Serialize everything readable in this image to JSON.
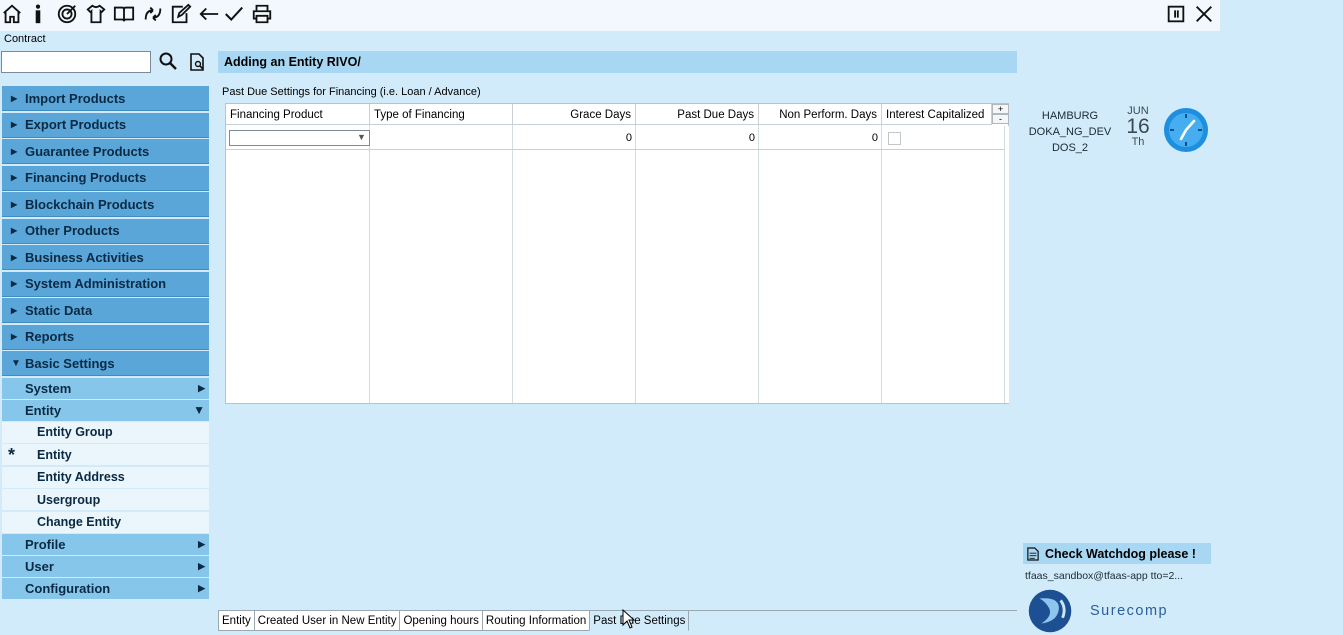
{
  "toolbar": {
    "icons": [
      "home-icon",
      "info-icon",
      "target-icon",
      "shirt-icon",
      "book-icon",
      "flow-icon",
      "edit-icon",
      "back-arrow-icon",
      "check-icon",
      "print-icon"
    ],
    "right_icons": [
      "window-toggle-icon",
      "close-icon"
    ]
  },
  "contract": {
    "label": "Contract",
    "value": ""
  },
  "sidebar": {
    "main_items": [
      {
        "label": "Import Products"
      },
      {
        "label": "Export Products"
      },
      {
        "label": "Guarantee Products"
      },
      {
        "label": "Financing Products"
      },
      {
        "label": "Blockchain Products"
      },
      {
        "label": "Other Products"
      },
      {
        "label": "Business Activities"
      },
      {
        "label": "System Administration"
      },
      {
        "label": "Static Data"
      },
      {
        "label": "Reports"
      },
      {
        "label": "Basic Settings"
      }
    ],
    "sub_items": {
      "system": "System",
      "entity": "Entity",
      "profile": "Profile",
      "user": "User",
      "configuration": "Configuration"
    },
    "entity_leaves": [
      {
        "label": "Entity Group"
      },
      {
        "label": "Entity"
      },
      {
        "label": "Entity Address"
      },
      {
        "label": "Usergroup"
      },
      {
        "label": "Change Entity"
      }
    ],
    "current_marker": "*"
  },
  "main": {
    "title": "Adding an Entity RIVO/",
    "section_label": "Past Due Settings for Financing (i.e. Loan / Advance)",
    "table": {
      "columns": [
        "Financing Product",
        "Type of Financing",
        "Grace Days",
        "Past Due Days",
        "Non Perform. Days",
        "Interest Capitalized"
      ],
      "row": {
        "financing_product": "",
        "type_of_financing": "",
        "grace_days": "0",
        "past_due_days": "0",
        "non_perform_days": "0",
        "interest_capitalized": false
      },
      "add_label": "+",
      "remove_label": "-"
    }
  },
  "info": {
    "location": "HAMBURG",
    "system": "DOKA_NG_DEV",
    "instance": "DOS_2",
    "month": "JUN",
    "day": "16",
    "weekday": "Th"
  },
  "watchdog": {
    "label": "Check Watchdog please !",
    "user": "tfaas_sandbox@tfaas-app tto=2..."
  },
  "logo_text": "Surecomp",
  "tabs": [
    {
      "label": "Entity"
    },
    {
      "label": "Created User in New Entity"
    },
    {
      "label": "Opening hours"
    },
    {
      "label": "Routing Information"
    },
    {
      "label": "Past Due Settings"
    }
  ]
}
